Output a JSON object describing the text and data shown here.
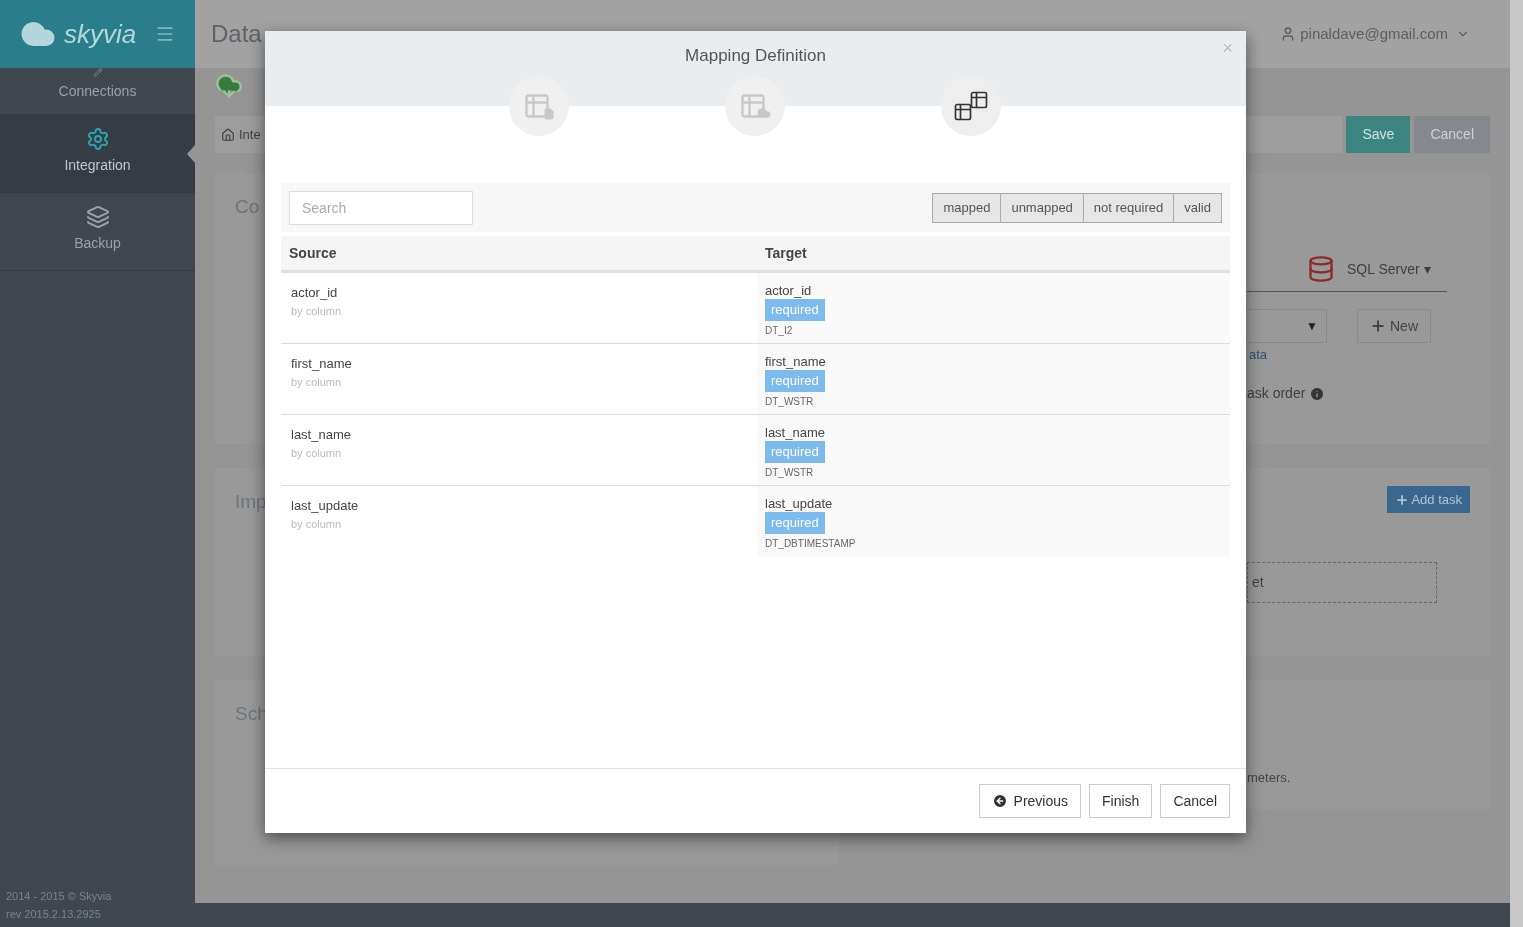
{
  "sidebar": {
    "logo": "skyvia",
    "items": [
      {
        "label": "Connections",
        "kind": "connections",
        "selected": false
      },
      {
        "label": "Integration",
        "kind": "gear",
        "selected": true
      },
      {
        "label": "Backup",
        "kind": "layers",
        "selected": false
      }
    ],
    "footer": [
      "2014 - 2015 © Skyvia",
      "rev 2015.2.13.2925"
    ]
  },
  "header": {
    "title": "Data",
    "user": "pinaldave@gmail.com"
  },
  "breadcrumb": "Inte",
  "toolbar_buttons": [
    {
      "label": "Save",
      "kind": "primary"
    },
    {
      "label": "Cancel",
      "kind": "secondary"
    }
  ],
  "left_cards": [
    "Co",
    "Imp",
    "Sch"
  ],
  "right_panel": {
    "connector": "SQL Server",
    "connector_caret": "▾",
    "select_caret": "▼",
    "new_button": "New",
    "link_fragment": "ata",
    "option_fragment": "ask order",
    "add_task": "Add task",
    "dropzone_fragment": "et",
    "note_fragment": "meters."
  },
  "modal": {
    "title": "Mapping Definition",
    "close": "×",
    "steps": [
      {
        "kind": "source",
        "selected": false
      },
      {
        "kind": "target",
        "selected": false
      },
      {
        "kind": "mapping",
        "selected": true
      }
    ],
    "search": {
      "placeholder": "Search"
    },
    "filters": [
      "mapped",
      "unmapped",
      "not required",
      "valid"
    ],
    "columns": [
      "Source",
      "Target"
    ],
    "rows": [
      {
        "source": "actor_id",
        "source_note": "by column",
        "target": "actor_id",
        "badge": "required",
        "type": "DT_I2"
      },
      {
        "source": "first_name",
        "source_note": "by column",
        "target": "first_name",
        "badge": "required",
        "type": "DT_WSTR"
      },
      {
        "source": "last_name",
        "source_note": "by column",
        "target": "last_name",
        "badge": "required",
        "type": "DT_WSTR"
      },
      {
        "source": "last_update",
        "source_note": "by column",
        "target": "last_update",
        "badge": "required",
        "type": "DT_DBTIMESTAMP"
      }
    ],
    "buttons": [
      {
        "label": "Previous",
        "kind": "back"
      },
      {
        "label": "Finish",
        "kind": "plain"
      },
      {
        "label": "Cancel",
        "kind": "plain"
      }
    ]
  }
}
